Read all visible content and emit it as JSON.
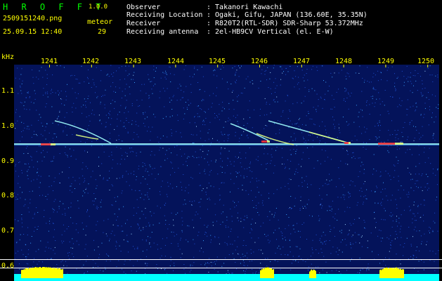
{
  "header": {
    "app_name": "H R O F F T",
    "version": "1.0.0",
    "filename": "2509151240.png",
    "datetime": "25.09.15 12:40",
    "meteor_label": "meteor",
    "meteor_count": "29",
    "info": [
      {
        "label": "Observer",
        "value": ": Takanori Kawachi"
      },
      {
        "label": "Receiving Location",
        "value": ": Ogaki, Gifu, JAPAN (136.60E, 35.35N)"
      },
      {
        "label": "Receiver",
        "value": ": R820T2(RTL-SDR) SDR-Sharp 53.372MHz"
      },
      {
        "label": "Receiving antenna",
        "value": ": 2el-HB9CV Vertical (el. E-W)"
      }
    ]
  },
  "axes": {
    "freq_unit": "kHz",
    "freq_ticks": [
      "1.1",
      "1.0",
      "0.9",
      "0.8",
      "0.7",
      "0.6"
    ],
    "time_ticks": [
      "1241",
      "1242",
      "1243",
      "1244",
      "1245",
      "1246",
      "1247",
      "1248",
      "1249",
      "1250"
    ]
  },
  "colors": {
    "background": "#000000",
    "spectrogram_bg": "#04135a",
    "noise": "#3aa0ff",
    "carrier": "#a0ffff",
    "echo": "#e0ff80",
    "hot": "#ff3030",
    "label_yellow": "#ffff00",
    "app_green": "#00ff00",
    "bar_yellow": "#ffff00",
    "bar_cyan": "#00ffff"
  }
}
